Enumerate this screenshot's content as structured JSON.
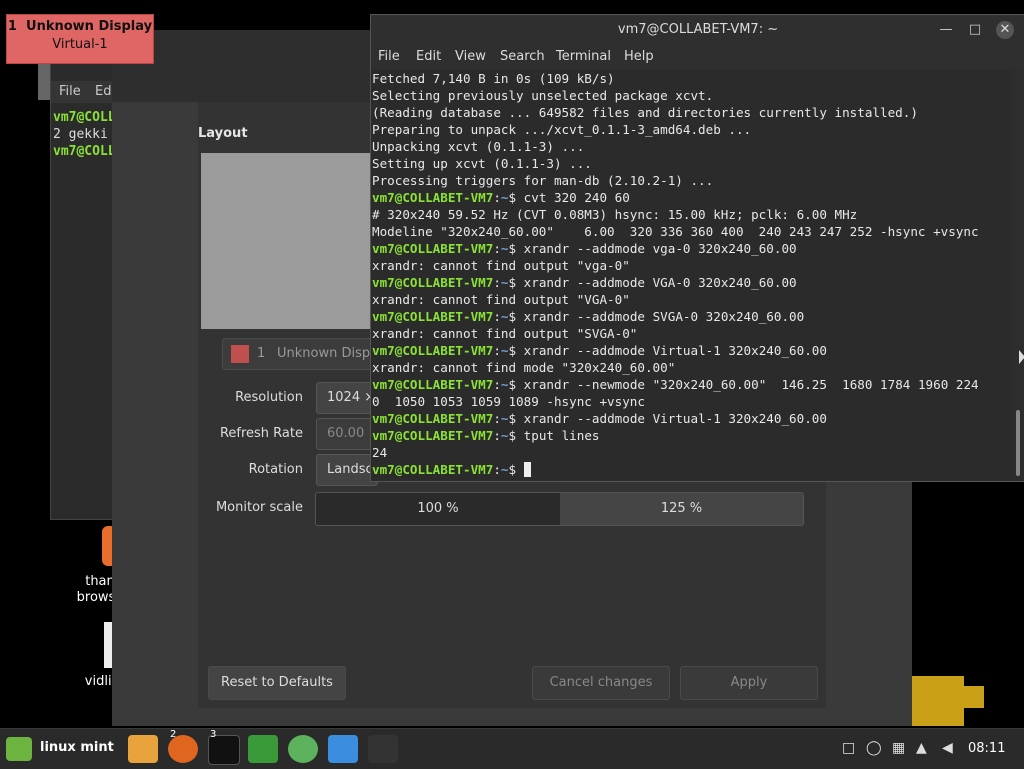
{
  "desktop": {
    "icons": [
      {
        "label_line1": "than",
        "label_line2": "browse"
      },
      {
        "label_line1": "vidlii"
      }
    ]
  },
  "bg_terminal": {
    "menu_file": "File",
    "menu_edit": "Ed",
    "lines": [
      {
        "prompt": "vm7@COLL",
        "rest": ""
      },
      {
        "prompt": "",
        "rest": "2 gekki"
      },
      {
        "prompt": "vm7@COLL",
        "rest": ""
      }
    ]
  },
  "display_badge": {
    "number": "1",
    "name": "Unknown Display",
    "output": "Virtual-1"
  },
  "display_settings": {
    "layout_label": "Layout",
    "monitor_num": "1",
    "monitor_name": "Unknown Displ",
    "resolution_label": "Resolution",
    "resolution_value": "1024 ×",
    "refresh_label": "Refresh Rate",
    "refresh_value": "60.00",
    "rotation_label": "Rotation",
    "rotation_value": "Landsc",
    "scale_label": "Monitor scale",
    "scale_options": [
      "100 %",
      "125 %"
    ],
    "reset_label": "Reset to Defaults",
    "cancel_label": "Cancel changes",
    "apply_label": "Apply"
  },
  "terminal": {
    "title": "vm7@COLLABET-VM7: ~",
    "menu": [
      "File",
      "Edit",
      "View",
      "Search",
      "Terminal",
      "Help"
    ],
    "prompt_user": "vm7@COLLABET-VM7",
    "prompt_path": "~",
    "lines": [
      {
        "type": "out",
        "text": "Fetched 7,140 B in 0s (109 kB/s)"
      },
      {
        "type": "out",
        "text": "Selecting previously unselected package xcvt."
      },
      {
        "type": "out",
        "text": "(Reading database ... 649582 files and directories currently installed.)"
      },
      {
        "type": "out",
        "text": "Preparing to unpack .../xcvt_0.1.1-3_amd64.deb ..."
      },
      {
        "type": "out",
        "text": "Unpacking xcvt (0.1.1-3) ..."
      },
      {
        "type": "out",
        "text": "Setting up xcvt (0.1.1-3) ..."
      },
      {
        "type": "out",
        "text": "Processing triggers for man-db (2.10.2-1) ..."
      },
      {
        "type": "cmd",
        "text": "cvt 320 240 60"
      },
      {
        "type": "out",
        "text": "# 320x240 59.52 Hz (CVT 0.08M3) hsync: 15.00 kHz; pclk: 6.00 MHz"
      },
      {
        "type": "out",
        "text": "Modeline \"320x240_60.00\"    6.00  320 336 360 400  240 243 247 252 -hsync +vsync"
      },
      {
        "type": "cmd",
        "text": "xrandr --addmode vga-0 320x240_60.00"
      },
      {
        "type": "out",
        "text": "xrandr: cannot find output \"vga-0\""
      },
      {
        "type": "cmd",
        "text": "xrandr --addmode VGA-0 320x240_60.00"
      },
      {
        "type": "out",
        "text": "xrandr: cannot find output \"VGA-0\""
      },
      {
        "type": "cmd",
        "text": "xrandr --addmode SVGA-0 320x240_60.00"
      },
      {
        "type": "out",
        "text": "xrandr: cannot find output \"SVGA-0\""
      },
      {
        "type": "cmd",
        "text": "xrandr --addmode Virtual-1 320x240_60.00"
      },
      {
        "type": "out",
        "text": "xrandr: cannot find mode \"320x240_60.00\""
      },
      {
        "type": "cmd",
        "text": "xrandr --newmode \"320x240_60.00\"  146.25  1680 1784 1960 224"
      },
      {
        "type": "out",
        "text": "0  1050 1053 1059 1089 -hsync +vsync"
      },
      {
        "type": "cmd",
        "text": "xrandr --addmode Virtual-1 320x240_60.00"
      },
      {
        "type": "cmd",
        "text": "tput lines"
      },
      {
        "type": "out",
        "text": "24"
      },
      {
        "type": "cmd",
        "text": ""
      }
    ]
  },
  "taskbar": {
    "menu_label": "linux mint",
    "badge_firefox": "2",
    "badge_terminal": "3",
    "clock": "08:11"
  },
  "colors": {
    "prompt_green": "#8ae234",
    "prompt_blue": "#729fcf",
    "badge_red": "#e06666",
    "mint_green": "#6cb33f"
  }
}
